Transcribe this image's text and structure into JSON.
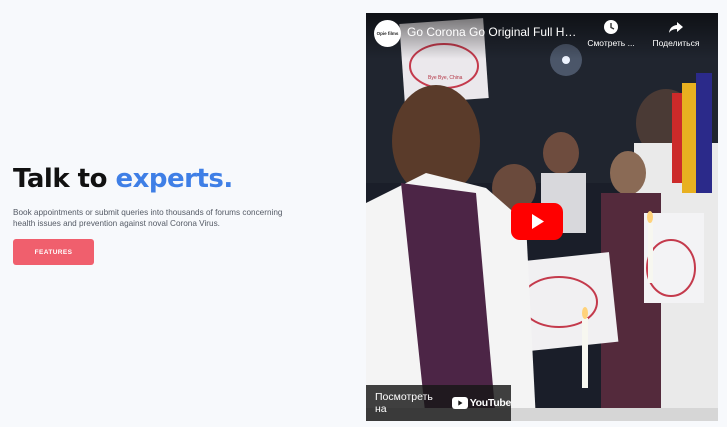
{
  "hero": {
    "title_plain": "Talk to ",
    "title_accent": "experts.",
    "description": "Book appointments or submit queries into thousands of forums concerning health issues and prevention against noval Corona Virus.",
    "cta_label": "FEATURES"
  },
  "video": {
    "channel_label": "Opie films",
    "title": "Go Corona Go Original Full HD...",
    "watch_later_label": "Смотреть ...",
    "share_label": "Поделиться",
    "watch_on_label": "Посмотреть на",
    "youtube_word": "YouTube",
    "sign_text": "Bye Bye, China"
  },
  "colors": {
    "accent": "#3f7fe6",
    "cta": "#f05f6d",
    "play": "#ff0000"
  }
}
